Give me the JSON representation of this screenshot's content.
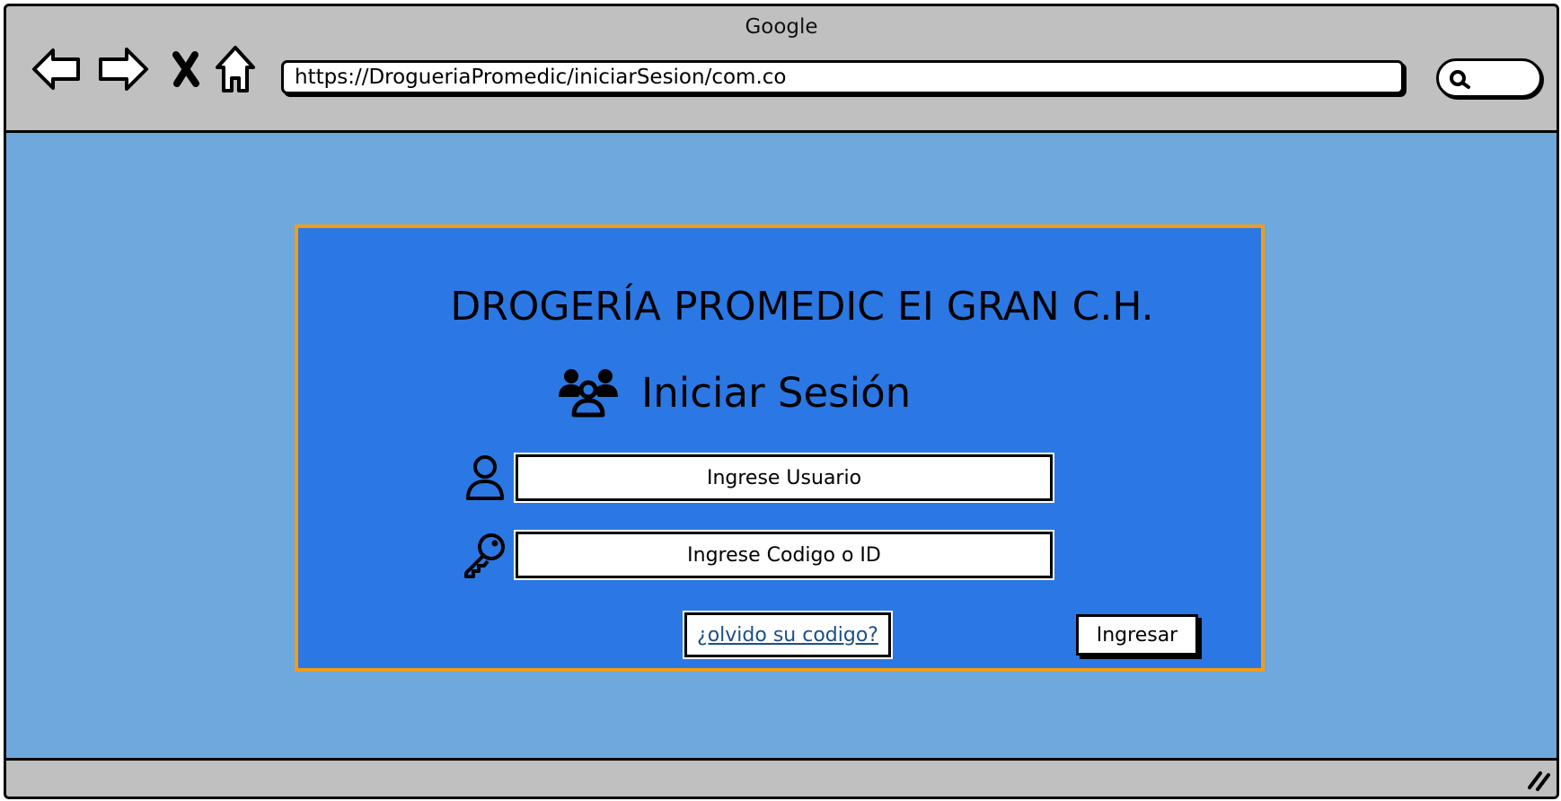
{
  "window": {
    "title": "Google"
  },
  "browser": {
    "url": "https://DrogueriaPromedic/iniciarSesion/com.co",
    "nav_icons": [
      "back-arrow-icon",
      "forward-arrow-icon",
      "close-icon",
      "home-icon"
    ],
    "search_icon": "search-icon"
  },
  "login": {
    "brand_title": "DROGERÍA PROMEDIC EI GRAN C.H.",
    "heading": "Iniciar Sesión",
    "heading_icon": "users-group-icon",
    "username_icon": "user-icon",
    "username_placeholder": "Ingrese Usuario",
    "code_icon": "key-icon",
    "code_placeholder": "Ingrese Codigo o ID",
    "forgot_link": "¿olvido su codigo?",
    "submit_label": "Ingresar"
  },
  "colors": {
    "browser_chrome": "#c0c0c0",
    "page_background": "#6fa8dc",
    "panel_background": "#2b78e4",
    "panel_border": "#f39c12",
    "link": "#1a4f8a"
  }
}
